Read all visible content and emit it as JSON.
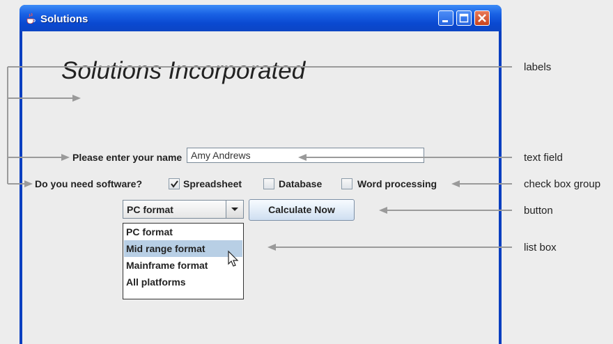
{
  "window": {
    "title": "Solutions",
    "controls": [
      "minimize",
      "maximize",
      "close"
    ]
  },
  "heading": "Solutions Incorporated",
  "name_row": {
    "label": "Please enter your name",
    "value": "Amy Andrews"
  },
  "software_row": {
    "label": "Do you need software?",
    "options": [
      {
        "label": "Spreadsheet",
        "checked": true
      },
      {
        "label": "Database",
        "checked": false
      },
      {
        "label": "Word processing",
        "checked": false
      }
    ]
  },
  "combo": {
    "selected": "PC format",
    "options": [
      "PC format",
      "Mid range format",
      "Mainframe format",
      "All platforms"
    ],
    "highlighted": "Mid range format"
  },
  "button": {
    "label": "Calculate Now"
  },
  "callouts": {
    "labels": "labels",
    "text_field": "text field",
    "check_box_group": "check box group",
    "button": "button",
    "list_box": "list box"
  },
  "colors": {
    "titlebar": "#0a49d1",
    "selection": "#b8cfe5",
    "callout_line": "#9a9a9a"
  }
}
